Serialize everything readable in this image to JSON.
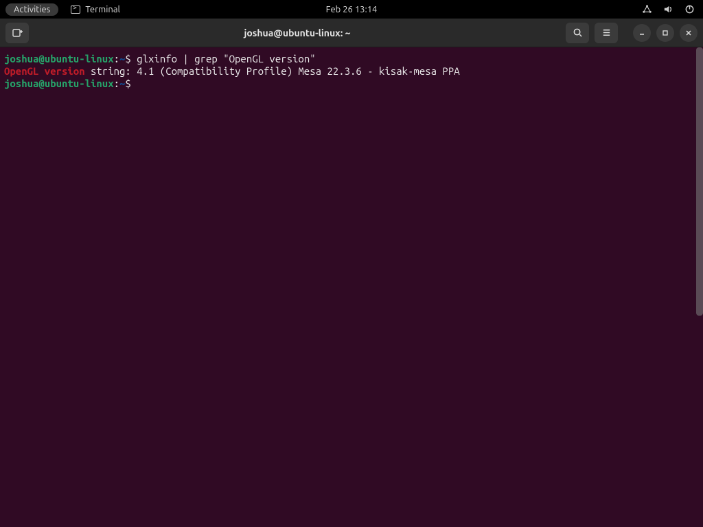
{
  "panel": {
    "activities_label": "Activities",
    "app_label": "Terminal",
    "clock": "Feb 26  13:14"
  },
  "window": {
    "title": "joshua@ubuntu-linux: ~"
  },
  "terminal": {
    "prompt_user": "joshua@ubuntu-linux",
    "prompt_colon": ":",
    "prompt_path": "~",
    "prompt_dollar": "$ ",
    "command1": "glxinfo | grep \"OpenGL version\"",
    "output_match": "OpenGL version",
    "output_rest": " string: 4.1 (Compatibility Profile) Mesa 22.3.6 - kisak-mesa PPA",
    "command2": ""
  },
  "icons": {
    "new_tab": "new-tab-icon",
    "search": "search-icon",
    "menu": "hamburger-icon",
    "minimize": "minimize-icon",
    "maximize": "maximize-icon",
    "close": "close-icon",
    "network": "network-icon",
    "volume": "volume-icon",
    "power": "power-icon",
    "terminal": "terminal-icon"
  }
}
